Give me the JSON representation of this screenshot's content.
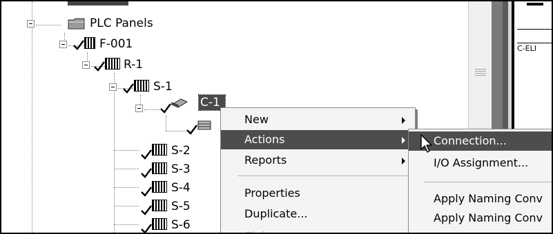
{
  "tree": {
    "top_item_partial": "",
    "nodes": [
      {
        "id": "plc-panels",
        "label": "PLC Panels",
        "checked": false
      },
      {
        "id": "f-001",
        "label": "F-001",
        "checked": true
      },
      {
        "id": "r-1",
        "label": "R-1",
        "checked": true
      },
      {
        "id": "s-1",
        "label": "S-1",
        "checked": true
      },
      {
        "id": "c-1",
        "label": "C-1",
        "checked": true,
        "selected": true
      },
      {
        "id": "s-2",
        "label": "S-2",
        "checked": true
      },
      {
        "id": "s-3",
        "label": "S-3",
        "checked": true
      },
      {
        "id": "s-4",
        "label": "S-4",
        "checked": true
      },
      {
        "id": "s-5",
        "label": "S-5",
        "checked": true
      },
      {
        "id": "s-6",
        "label": "S-6",
        "checked": true
      }
    ]
  },
  "context_menu": {
    "items": [
      {
        "label": "New",
        "submenu": true
      },
      {
        "label": "Actions",
        "submenu": true,
        "highlighted": true
      },
      {
        "label": "Reports",
        "submenu": true
      },
      {
        "label": "Properties"
      },
      {
        "label": "Duplicate..."
      },
      {
        "label": "Claim",
        "disabled": true
      }
    ]
  },
  "actions_submenu": {
    "items": [
      {
        "label": "Connection...",
        "highlighted": true
      },
      {
        "label": "I/O Assignment..."
      },
      {
        "label": "Apply Naming Conv"
      },
      {
        "label": "Apply Naming Conv"
      }
    ]
  },
  "right_panel": {
    "tag_text": "C-ELI"
  },
  "colors": {
    "menu_highlight": "#4d4d4d",
    "menu_background": "#f4f4f4",
    "selection": "#4a4a4a"
  }
}
